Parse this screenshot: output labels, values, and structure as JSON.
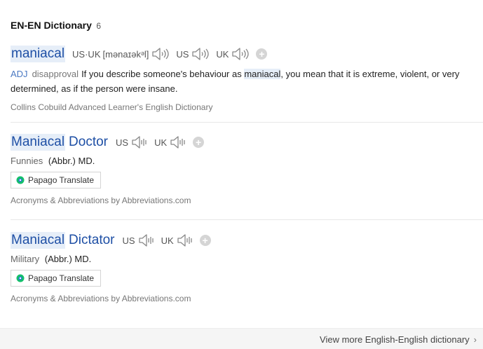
{
  "section": {
    "title": "EN-EN Dictionary",
    "count": "6"
  },
  "entries": [
    {
      "headword": "maniacal",
      "pron_label": "US·UK",
      "pron": "[mənaɪəkᵊl]",
      "audio": [
        {
          "label": "US"
        },
        {
          "label": "UK"
        }
      ],
      "pos": "ADJ",
      "domain": "disapproval",
      "def_before": "If you describe someone's behaviour as ",
      "def_keyword": "maniacal",
      "def_after": ", you mean that it is extreme, violent, or very determined, as if the person were insane.",
      "source": "Collins Cobuild Advanced Learner's English Dictionary"
    },
    {
      "headword_a": "Maniacal",
      "headword_b": "Doctor",
      "audio": [
        {
          "label": "US"
        },
        {
          "label": "UK"
        }
      ],
      "category": "Funnies",
      "abbr": "(Abbr.) MD.",
      "translate": "Papago Translate",
      "source": "Acronyms & Abbreviations by Abbreviations.com"
    },
    {
      "headword_a": "Maniacal",
      "headword_b": "Dictator",
      "audio": [
        {
          "label": "US"
        },
        {
          "label": "UK"
        }
      ],
      "category": "Military",
      "abbr": "(Abbr.) MD.",
      "translate": "Papago Translate",
      "source": "Acronyms & Abbreviations by Abbreviations.com"
    }
  ],
  "footer": {
    "more_link": "View more English-English dictionary"
  },
  "colors": {
    "headword": "#1e4fa5",
    "highlight": "#e6eef8",
    "pos": "#4a78c2",
    "papago_green": "#14c06a",
    "papago_blue": "#2a73d9"
  }
}
